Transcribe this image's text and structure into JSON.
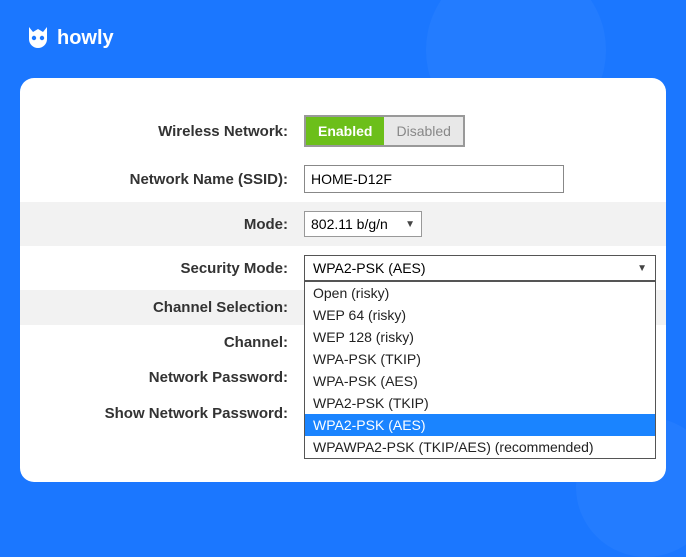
{
  "brand": "howly",
  "fields": {
    "wireless_network": {
      "label": "Wireless Network:",
      "enabled_label": "Enabled",
      "disabled_label": "Disabled"
    },
    "ssid": {
      "label": "Network Name (SSID):",
      "value": "HOME-D12F"
    },
    "mode": {
      "label": "Mode:",
      "value": "802.11 b/g/n"
    },
    "security_mode": {
      "label": "Security Mode:",
      "value": "WPA2-PSK (AES)",
      "options": [
        "Open (risky)",
        "WEP 64 (risky)",
        "WEP 128 (risky)",
        "WPA-PSK (TKIP)",
        "WPA-PSK (AES)",
        "WPA2-PSK (TKIP)",
        "WPA2-PSK (AES)",
        "WPAWPA2-PSK (TKIP/AES) (recommended)"
      ],
      "selected_index": 6
    },
    "channel_selection": {
      "label": "Channel Selection:"
    },
    "channel": {
      "label": "Channel:"
    },
    "network_password": {
      "label": "Network Password:"
    },
    "show_password": {
      "label": "Show Network Password:",
      "checked": true
    }
  }
}
